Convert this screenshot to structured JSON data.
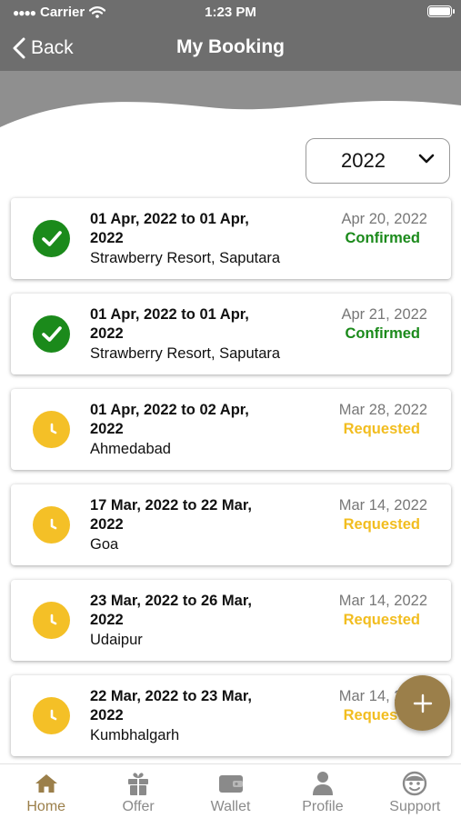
{
  "status_bar": {
    "carrier": "Carrier",
    "time": "1:23 PM"
  },
  "nav": {
    "back_label": "Back",
    "title": "My Booking"
  },
  "filter": {
    "year": "2022"
  },
  "colors": {
    "accent": "#9b7f4a",
    "confirmed": "#1b8a1b",
    "requested": "#f2bd1f",
    "header": "#6e6e6e"
  },
  "bookings": [
    {
      "dates": "01 Apr, 2022 to 01 Apr, 2022",
      "place": "Strawberry Resort, Saputara",
      "request_date": "Apr 20, 2022",
      "status": "Confirmed",
      "icon": "check-circle-icon"
    },
    {
      "dates": "01 Apr, 2022 to 01 Apr, 2022",
      "place": "Strawberry Resort, Saputara",
      "request_date": "Apr 21, 2022",
      "status": "Confirmed",
      "icon": "check-circle-icon"
    },
    {
      "dates": "01 Apr, 2022 to 02 Apr, 2022",
      "place": "Ahmedabad",
      "request_date": "Mar 28, 2022",
      "status": "Requested",
      "icon": "clock-icon"
    },
    {
      "dates": "17 Mar, 2022 to 22 Mar, 2022",
      "place": "Goa",
      "request_date": "Mar 14, 2022",
      "status": "Requested",
      "icon": "clock-icon"
    },
    {
      "dates": "23 Mar, 2022 to 26 Mar, 2022",
      "place": "Udaipur",
      "request_date": "Mar 14, 2022",
      "status": "Requested",
      "icon": "clock-icon"
    },
    {
      "dates": "22 Mar, 2022 to 23 Mar, 2022",
      "place": "Kumbhalgarh",
      "request_date": "Mar 14, 2022",
      "status": "Requested",
      "icon": "clock-icon"
    }
  ],
  "fab": {
    "icon": "plus-icon"
  },
  "tabs": [
    {
      "label": "Home",
      "icon": "home-icon",
      "active": true
    },
    {
      "label": "Offer",
      "icon": "gift-icon",
      "active": false
    },
    {
      "label": "Wallet",
      "icon": "wallet-icon",
      "active": false
    },
    {
      "label": "Profile",
      "icon": "person-icon",
      "active": false
    },
    {
      "label": "Support",
      "icon": "support-icon",
      "active": false
    }
  ]
}
